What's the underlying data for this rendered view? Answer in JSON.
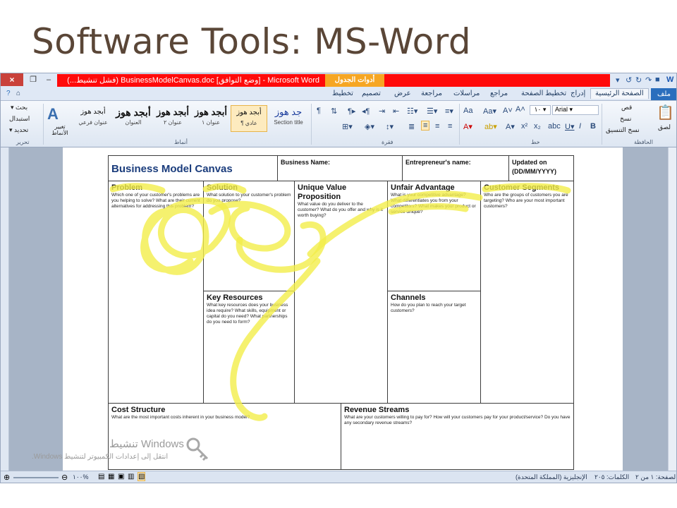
{
  "slide": {
    "title": "Software Tools: MS-Word"
  },
  "window": {
    "title": "Microsoft Word - [وضع التوافق] BusinessModelCanvas.doc (فشل تنشيط...)",
    "contextual_tab": "أدوات الجدول",
    "close_label": "×",
    "colors": {
      "red_bar": "#ff0a0a",
      "context_tab": "#f6a623",
      "file_tab": "#2a6ebd"
    }
  },
  "ribbon": {
    "tabs": [
      "ملف",
      "الصفحة الرئيسية",
      "إدراج",
      "تخطيط الصفحة",
      "مراجع",
      "مراسلات",
      "مراجعة",
      "عرض",
      "تصميم",
      "تخطيط"
    ],
    "clipboard": {
      "paste": "لصق",
      "cut": "قص",
      "copy": "نسخ",
      "format_painter": "نسخ التنسيق",
      "group": "الحافظة"
    },
    "font": {
      "name": "Arial",
      "size": "١٠",
      "group": "خط"
    },
    "paragraph": {
      "group": "فقرة"
    },
    "styles": {
      "group": "أنماط",
      "cards": [
        {
          "big": "جد هوز",
          "small": "Section title"
        },
        {
          "big": "أبجد هوز",
          "small": "¶ عادي"
        },
        {
          "big": "أبجد هوز",
          "small": "عنوان ١"
        },
        {
          "big": "أبجد هوز",
          "small": "عنوان ٢"
        },
        {
          "big": "أبجد هوز",
          "small": "العنوان"
        },
        {
          "big": "أبجد هوز",
          "small": "عنوان فرعي"
        }
      ],
      "change_styles": "تغيير الأنماط"
    },
    "editing": {
      "find": "بحث",
      "replace": "استبدال",
      "select": "تحديد",
      "group": "تحرير"
    }
  },
  "canvas": {
    "title": "Business Model Canvas",
    "business_name": "Business Name:",
    "entrepreneur": "Entrepreneur's name:",
    "updated": "Updated on (DD/MM/YYYY)",
    "problem": {
      "title": "Problem",
      "text": "Which one of your customer's problems are you helping to solve? What are their current alternatives for addressing this problem?"
    },
    "solution": {
      "title": "Solution",
      "text": "What solution to your customer's problem do you propose?"
    },
    "uvp": {
      "title": "Unique Value Proposition",
      "text": "What value do you deliver to the customer? What do you offer and why is it worth buying?"
    },
    "unfair": {
      "title": "Unfair Advantage",
      "text": "What is your competitive advantage? What differentiates you from your competitors? What makes your product or service unique?"
    },
    "segments": {
      "title": "Customer Segments",
      "text": "Who are the groups of customers you are targeting? Who are your most important customers?"
    },
    "resources": {
      "title": "Key Resources",
      "text": "What key resources does your business idea require? What skills, equipment or capital do you need? What partnerships do you need to form?"
    },
    "channels": {
      "title": "Channels",
      "text": "How do you plan to reach your target customers?"
    },
    "cost": {
      "title": "Cost Structure",
      "text": "What are the most important costs inherent in your business model?"
    },
    "revenue": {
      "title": "Revenue Streams",
      "text": "What are your customers willing to pay for? How will your customers pay for your product/service? Do you have any secondary revenue streams?"
    }
  },
  "statusbar": {
    "page": "الصفحة: ١ من ٢",
    "words": "الكلمات: ٢٠٥",
    "language": "الإنجليزية (المملكة المتحدة)",
    "zoom": "%١٠٠"
  },
  "watermark": {
    "line1": "تنشيط Windows",
    "line2": "انتقل إلى إعدادات الكمبيوتر لتنشيط Windows."
  }
}
